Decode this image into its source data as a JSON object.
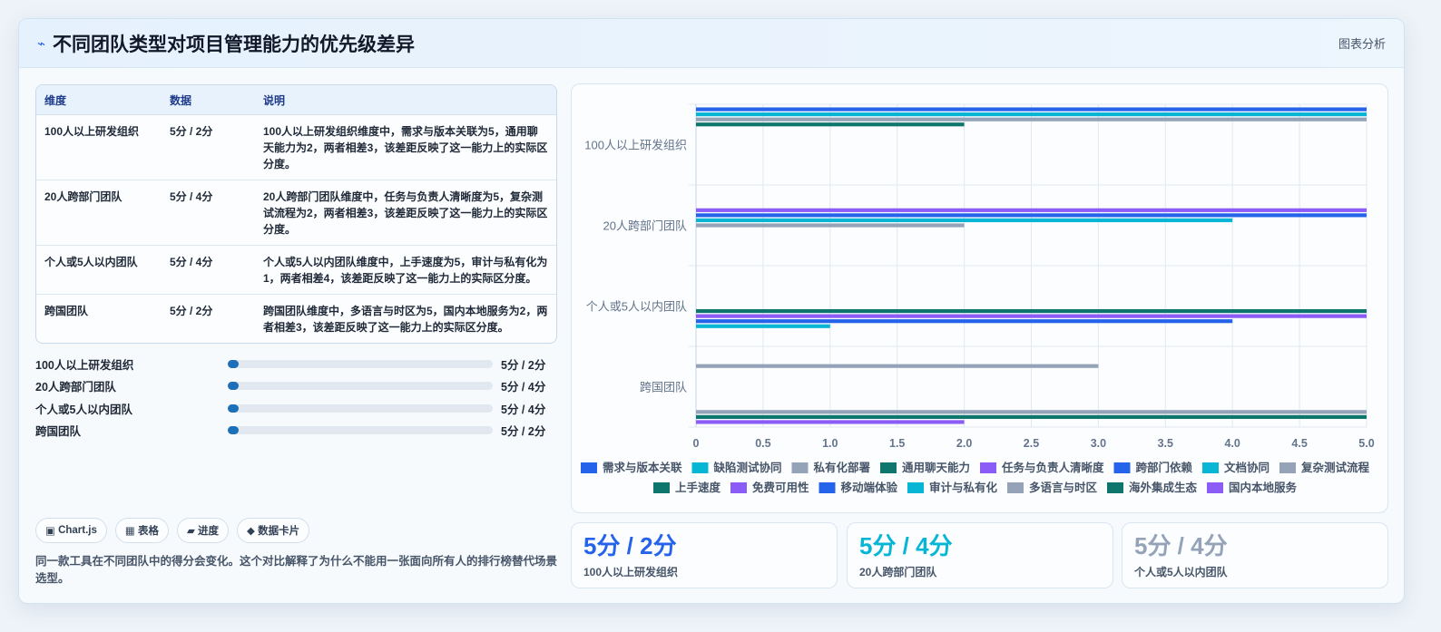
{
  "header": {
    "title": "不同团队类型对项目管理能力的优先级差异",
    "analysis_label": "图表分析"
  },
  "table": {
    "columns": [
      "维度",
      "数据",
      "说明"
    ],
    "rows": [
      {
        "dim": "100人以上研发组织",
        "data": "5分 / 2分",
        "desc": "100人以上研发组织维度中，需求与版本关联为5，通用聊天能力为2，两者相差3，该差距反映了这一能力上的实际区分度。"
      },
      {
        "dim": "20人跨部门团队",
        "data": "5分 / 4分",
        "desc": "20人跨部门团队维度中，任务与负责人清晰度为5，复杂测试流程为2，两者相差3，该差距反映了这一能力上的实际区分度。"
      },
      {
        "dim": "个人或5人以内团队",
        "data": "5分 / 4分",
        "desc": "个人或5人以内团队维度中，上手速度为5，审计与私有化为1，两者相差4，该差距反映了这一能力上的实际区分度。"
      },
      {
        "dim": "跨国团队",
        "data": "5分 / 2分",
        "desc": "跨国团队维度中，多语言与时区为5，国内本地服务为2，两者相差3，该差距反映了这一能力上的实际区分度。"
      }
    ]
  },
  "progress": [
    {
      "label": "100人以上研发组织",
      "value": "5分 / 2分",
      "fraction": 0.0
    },
    {
      "label": "20人跨部门团队",
      "value": "5分 / 4分",
      "fraction": 0.0
    },
    {
      "label": "个人或5人以内团队",
      "value": "5分 / 4分",
      "fraction": 0.0
    },
    {
      "label": "跨国团队",
      "value": "5分 / 2分",
      "fraction": 0.0
    }
  ],
  "tags": [
    {
      "icon": "▣",
      "label": "Chart.js"
    },
    {
      "icon": "▦",
      "label": "表格"
    },
    {
      "icon": "▰",
      "label": "进度"
    },
    {
      "icon": "◆",
      "label": "数据卡片"
    }
  ],
  "note": "同一款工具在不同团队中的得分会变化。这个对比解释了为什么不能用一张面向所有人的排行榜替代场景选型。",
  "stats": [
    {
      "value": "5分 / 2分",
      "label": "100人以上研发组织",
      "color": "#2563eb"
    },
    {
      "value": "5分 / 4分",
      "label": "20人跨部门团队",
      "color": "#06b6d4"
    },
    {
      "value": "5分 / 4分",
      "label": "个人或5人以内团队",
      "color": "#94a3b8"
    }
  ],
  "chart_data": {
    "type": "bar",
    "orientation": "horizontal",
    "categories": [
      "100人以上研发组织",
      "20人跨部门团队",
      "个人或5人以内团队",
      "跨国团队"
    ],
    "xlim": [
      0,
      5
    ],
    "xticks": [
      "0",
      "0.5",
      "1.0",
      "1.5",
      "2.0",
      "2.5",
      "3.0",
      "3.5",
      "4.0",
      "4.5",
      "5.0"
    ],
    "grid": true,
    "legend_position": "bottom",
    "series": [
      {
        "name": "需求与版本关联",
        "color": "#2563eb",
        "values": [
          5,
          null,
          null,
          null
        ]
      },
      {
        "name": "缺陷测试协同",
        "color": "#06b6d4",
        "values": [
          5,
          null,
          null,
          null
        ]
      },
      {
        "name": "私有化部署",
        "color": "#94a3b8",
        "values": [
          5,
          null,
          null,
          null
        ]
      },
      {
        "name": "通用聊天能力",
        "color": "#0f766e",
        "values": [
          2,
          null,
          null,
          null
        ]
      },
      {
        "name": "任务与负责人清晰度",
        "color": "#8b5cf6",
        "values": [
          null,
          5,
          null,
          null
        ]
      },
      {
        "name": "跨部门依赖",
        "color": "#2563eb",
        "values": [
          null,
          5,
          null,
          null
        ]
      },
      {
        "name": "文档协同",
        "color": "#06b6d4",
        "values": [
          null,
          4,
          null,
          null
        ]
      },
      {
        "name": "复杂测试流程",
        "color": "#94a3b8",
        "values": [
          null,
          2,
          null,
          null
        ]
      },
      {
        "name": "上手速度",
        "color": "#0f766e",
        "values": [
          null,
          null,
          5,
          null
        ]
      },
      {
        "name": "免费可用性",
        "color": "#8b5cf6",
        "values": [
          null,
          null,
          5,
          null
        ]
      },
      {
        "name": "移动端体验",
        "color": "#2563eb",
        "values": [
          null,
          null,
          4,
          null
        ]
      },
      {
        "name": "审计与私有化",
        "color": "#06b6d4",
        "values": [
          null,
          null,
          1,
          null
        ]
      },
      {
        "name": "多语言与时区",
        "color": "#94a3b8",
        "values": [
          null,
          null,
          null,
          5
        ]
      },
      {
        "name": "海外集成生态",
        "color": "#0f766e",
        "values": [
          null,
          null,
          null,
          5
        ]
      },
      {
        "name": "国内本地服务",
        "color": "#8b5cf6",
        "values": [
          null,
          null,
          null,
          2
        ]
      }
    ],
    "extra_bars": [
      {
        "category_index": 3,
        "value": 3,
        "color": "#94a3b8"
      }
    ]
  }
}
